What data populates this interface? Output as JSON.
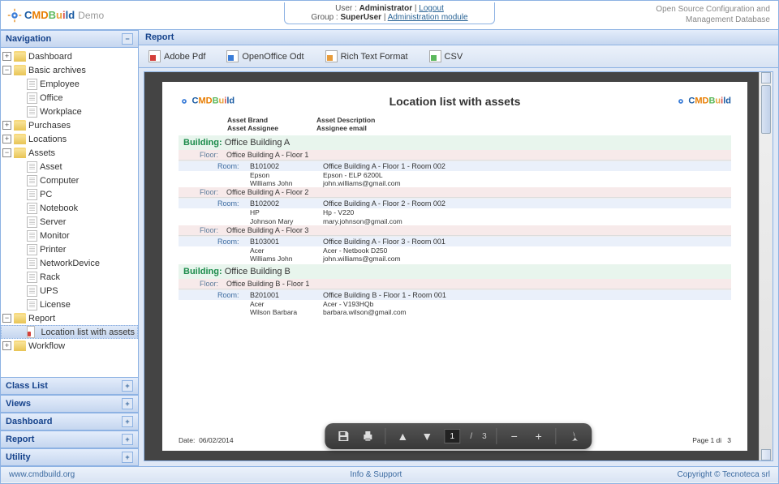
{
  "app": {
    "name_letters": [
      "C",
      "M",
      "D",
      "B",
      "u",
      "i",
      "l",
      "d"
    ],
    "demo_label": "Demo",
    "tagline1": "Open Source Configuration and",
    "tagline2": "Management Database"
  },
  "header": {
    "user_label": "User : ",
    "user_name": "Administrator",
    "logout": "Logout",
    "group_label": "Group : ",
    "group_name": "SuperUser",
    "admin_module": "Administration module"
  },
  "sidebar": {
    "title": "Navigation",
    "tree": [
      {
        "t": "folder",
        "ind": 0,
        "exp": "+",
        "label": "Dashboard"
      },
      {
        "t": "folder",
        "ind": 0,
        "exp": "−",
        "label": "Basic archives"
      },
      {
        "t": "leaf",
        "ind": 1,
        "label": "Employee"
      },
      {
        "t": "leaf",
        "ind": 1,
        "label": "Office"
      },
      {
        "t": "leaf",
        "ind": 1,
        "label": "Workplace"
      },
      {
        "t": "folder",
        "ind": 0,
        "exp": "+",
        "label": "Purchases"
      },
      {
        "t": "folder",
        "ind": 0,
        "exp": "+",
        "label": "Locations"
      },
      {
        "t": "folder",
        "ind": 0,
        "exp": "−",
        "label": "Assets"
      },
      {
        "t": "leaf",
        "ind": 1,
        "label": "Asset"
      },
      {
        "t": "leaf",
        "ind": 1,
        "label": "Computer"
      },
      {
        "t": "leaf",
        "ind": 1,
        "label": "PC"
      },
      {
        "t": "leaf",
        "ind": 1,
        "label": "Notebook"
      },
      {
        "t": "leaf",
        "ind": 1,
        "label": "Server"
      },
      {
        "t": "leaf",
        "ind": 1,
        "label": "Monitor"
      },
      {
        "t": "leaf",
        "ind": 1,
        "label": "Printer"
      },
      {
        "t": "leaf",
        "ind": 1,
        "label": "NetworkDevice"
      },
      {
        "t": "leaf",
        "ind": 1,
        "label": "Rack"
      },
      {
        "t": "leaf",
        "ind": 1,
        "label": "UPS"
      },
      {
        "t": "leaf",
        "ind": 1,
        "label": "License"
      },
      {
        "t": "folder",
        "ind": 0,
        "exp": "−",
        "label": "Report"
      },
      {
        "t": "pdf",
        "ind": 1,
        "label": "Location list with assets",
        "selected": true
      },
      {
        "t": "folder",
        "ind": 0,
        "exp": "+",
        "label": "Workflow"
      }
    ],
    "bottom_panels": [
      "Class List",
      "Views",
      "Dashboard",
      "Report",
      "Utility"
    ]
  },
  "content": {
    "title": "Report",
    "toolbar": [
      {
        "icon": "pdf",
        "label": "Adobe Pdf"
      },
      {
        "icon": "odt",
        "label": "OpenOffice Odt"
      },
      {
        "icon": "rtf",
        "label": "Rich Text Format"
      },
      {
        "icon": "csv",
        "label": "CSV"
      }
    ]
  },
  "report": {
    "title": "Location list with assets",
    "col_headers": {
      "brand": "Asset Brand",
      "desc": "Asset Description",
      "assignee": "Asset Assignee",
      "email": "Assignee email"
    },
    "buildings": [
      {
        "name": "Office Building A",
        "floors": [
          {
            "name": "Office Building A - Floor 1",
            "rooms": [
              {
                "code": "B101002",
                "desc": "Office Building A - Floor 1 - Room 002",
                "assets": [
                  {
                    "brand": "Epson",
                    "desc": "Epson - ELP 6200L"
                  },
                  {
                    "brand": "Williams John",
                    "desc": "john.williams@gmail.com"
                  }
                ]
              }
            ]
          },
          {
            "name": "Office Building A - Floor 2",
            "rooms": [
              {
                "code": "B102002",
                "desc": "Office Building A - Floor 2 - Room 002",
                "assets": [
                  {
                    "brand": "HP",
                    "desc": "Hp - V220"
                  },
                  {
                    "brand": "Johnson Mary",
                    "desc": "mary.johnson@gmail.com"
                  }
                ]
              }
            ]
          },
          {
            "name": "Office Building A - Floor 3",
            "rooms": [
              {
                "code": "B103001",
                "desc": "Office Building A - Floor 3 - Room 001",
                "assets": [
                  {
                    "brand": "Acer",
                    "desc": "Acer - Netbook D250"
                  },
                  {
                    "brand": "Williams John",
                    "desc": "john.williams@gmail.com"
                  }
                ]
              }
            ]
          }
        ]
      },
      {
        "name": "Office Building B",
        "floors": [
          {
            "name": "Office Building B - Floor 1",
            "rooms": [
              {
                "code": "B201001",
                "desc": "Office Building B - Floor 1 - Room 001",
                "assets": [
                  {
                    "brand": "Acer",
                    "desc": "Acer - V193HQb"
                  },
                  {
                    "brand": "Wilson Barbara",
                    "desc": "barbara.wilson@gmail.com"
                  }
                ]
              }
            ]
          }
        ]
      }
    ],
    "labels": {
      "building": "Building:",
      "floor": "Floor:",
      "room": "Room:",
      "date_label": "Date:",
      "date": "06/02/2014",
      "page_label": "Page 1 di",
      "total_pages": "3"
    }
  },
  "pdf_toolbar": {
    "page": "1",
    "sep": "/",
    "total": "3"
  },
  "footer": {
    "left": "www.cmdbuild.org",
    "center": "Info & Support",
    "right": "Copyright © Tecnoteca srl"
  }
}
